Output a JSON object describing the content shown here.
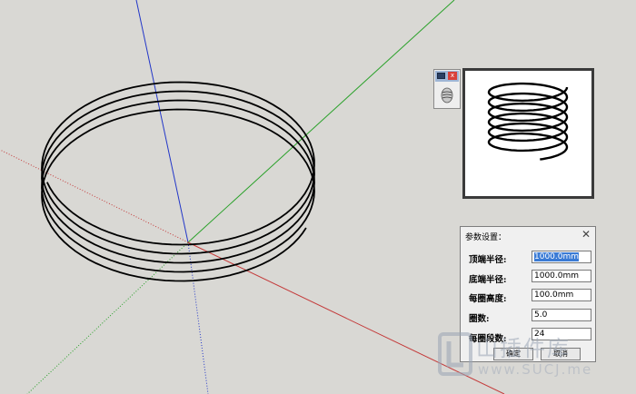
{
  "viewport": {
    "axis_colors": {
      "blue": "#2236c8",
      "green": "#2aa12a",
      "red": "#c43a3a"
    },
    "background": "#d9d8d4"
  },
  "mini_toolbar": {
    "close_glyph": "x",
    "icons": [
      "window-icon",
      "close-icon",
      "spring-icon"
    ]
  },
  "dialog": {
    "title": "参数设置：",
    "close_glyph": "✕",
    "fields": [
      {
        "label": "顶端半径:",
        "value": "1000.0mm",
        "selected": true
      },
      {
        "label": "底端半径:",
        "value": "1000.0mm",
        "selected": false
      },
      {
        "label": "每圈高度:",
        "value": "100.0mm",
        "selected": false
      },
      {
        "label": "圈数:",
        "value": "5.0",
        "selected": false
      },
      {
        "label": "每圈段数:",
        "value": "24",
        "selected": false
      }
    ],
    "ok_label": "确定",
    "cancel_label": "取消"
  },
  "watermark": {
    "text_cn": "山插件库",
    "url": "www.SUCJ.me"
  }
}
